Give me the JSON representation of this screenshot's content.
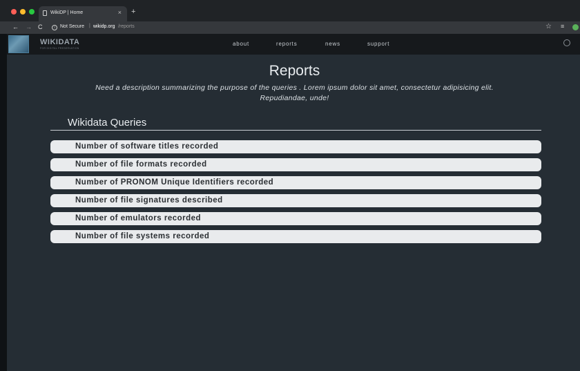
{
  "browser": {
    "tab_title": "WikiDP | Home",
    "tab_close": "×",
    "new_tab": "+",
    "nav": {
      "back": "←",
      "forward": "→",
      "reload": "C"
    },
    "security": "Not Secure",
    "url_separator": "|",
    "url_host": "wikidp.org",
    "url_path": "/reports",
    "star": "☆",
    "menu": "≡",
    "colors": {
      "close": "#ff5f57",
      "minimize": "#febc2e",
      "maximize": "#28c840"
    }
  },
  "site": {
    "logo_text": "WIKIDATA",
    "logo_subtext": "FOR DIGITAL PRESERVATION",
    "nav": [
      {
        "label": "about"
      },
      {
        "label": "reports"
      },
      {
        "label": "news"
      },
      {
        "label": "support"
      }
    ]
  },
  "page": {
    "title": "Reports",
    "description": "Need a description summarizing the purpose of the queries . Lorem ipsum dolor sit amet, consectetur adipisicing elit. Repudiandae, unde!",
    "section_title": "Wikidata Queries",
    "queries": [
      "Number of software titles recorded",
      "Number of file formats recorded",
      "Number of PRONOM Unique Identifiers recorded",
      "Number of file signatures described",
      "Number of emulators recorded",
      "Number of file systems recorded"
    ]
  }
}
